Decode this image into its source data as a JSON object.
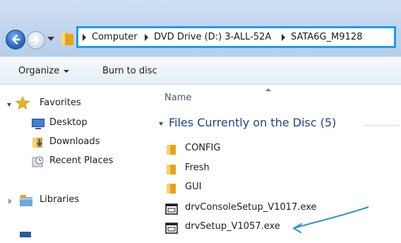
{
  "window": {
    "accent_color": "#1a9fe6",
    "title_bar_color": "#bfd4ed"
  },
  "nav": {
    "back_icon": "back-arrow-icon",
    "forward_icon": "forward-arrow-icon",
    "recent_icon": "chevron-down-icon"
  },
  "address_bar": {
    "crumbs": [
      "Computer",
      "DVD Drive (D:) 3-ALL-52A",
      "SATA6G_M9128"
    ]
  },
  "command_bar": {
    "organize_label": "Organize",
    "burn_label": "Burn to disc"
  },
  "nav_pane": {
    "favorites_label": "Favorites",
    "items": [
      {
        "label": "Desktop",
        "icon": "desktop-icon"
      },
      {
        "label": "Downloads",
        "icon": "downloads-icon"
      },
      {
        "label": "Recent Places",
        "icon": "recent-places-icon"
      }
    ],
    "libraries_label": "Libraries"
  },
  "content": {
    "column_name": "Name",
    "group_title": "Files Currently on the Disc (5)",
    "files": [
      {
        "name": "CONFIG",
        "icon": "folder-icon"
      },
      {
        "name": "Fresh",
        "icon": "folder-icon"
      },
      {
        "name": "GUI",
        "icon": "folder-icon"
      },
      {
        "name": "drvConsoleSetup_V1017.exe",
        "icon": "exe-icon"
      },
      {
        "name": "drvSetup_V1057.exe",
        "icon": "exe-icon"
      }
    ],
    "annotation_color": "#2a92d8"
  }
}
